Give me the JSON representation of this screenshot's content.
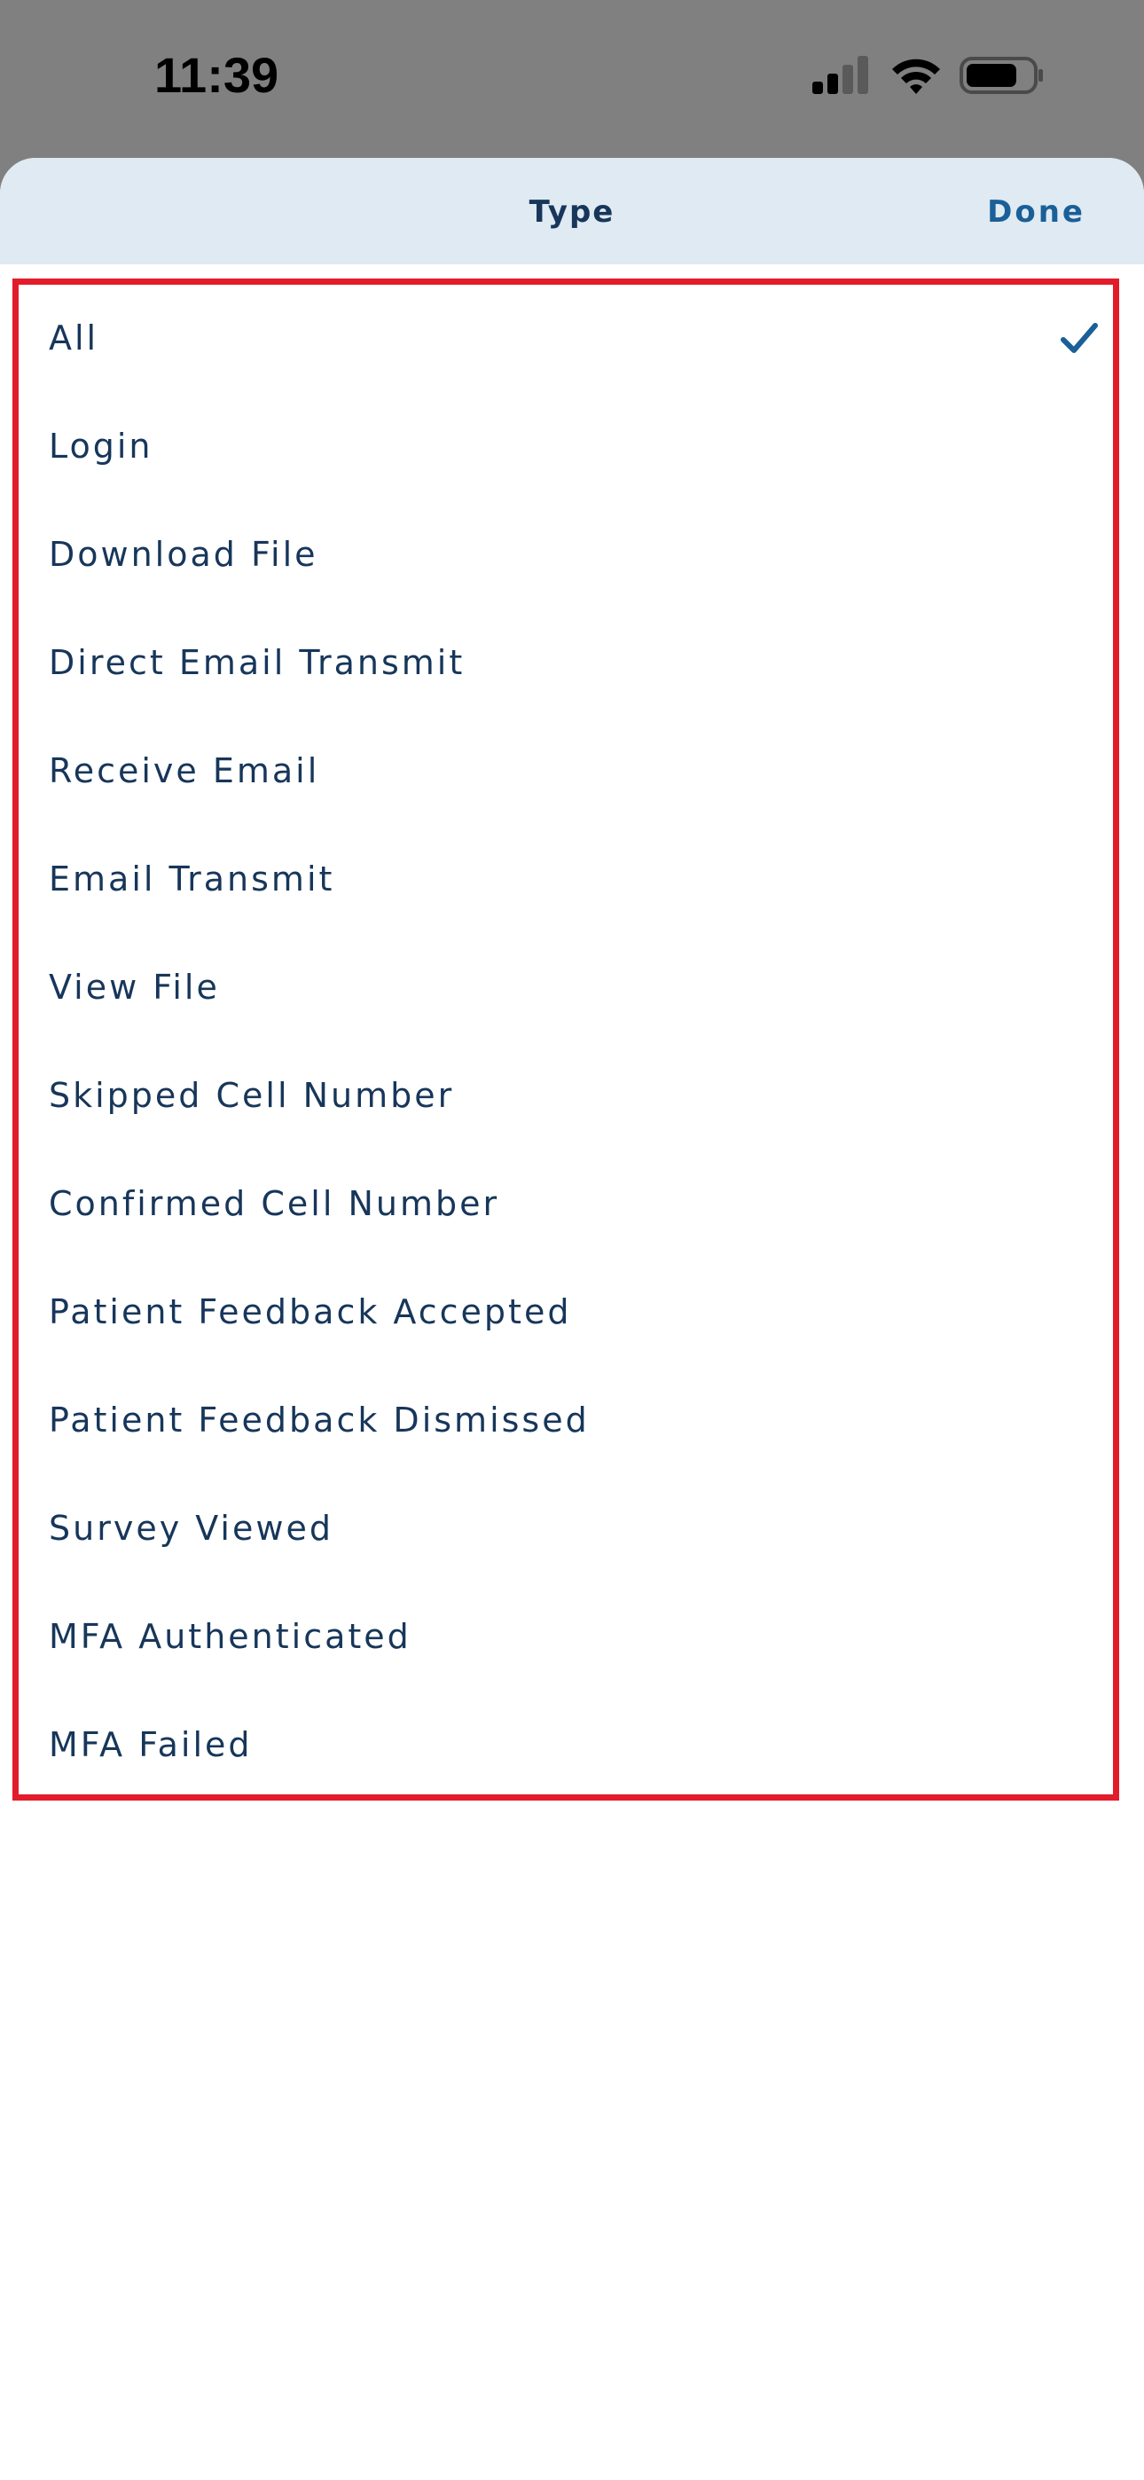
{
  "status_bar": {
    "time": "11:39",
    "signal_icon": "cellular-signal-icon",
    "wifi_icon": "wifi-icon",
    "battery_icon": "battery-icon"
  },
  "sheet": {
    "title": "Type",
    "done_label": "Done",
    "selected_index": 0,
    "options": [
      "All",
      "Login",
      "Download File",
      "Direct Email Transmit",
      "Receive Email",
      "Email Transmit",
      "View File",
      "Skipped Cell Number",
      "Confirmed Cell Number",
      "Patient Feedback Accepted",
      "Patient Feedback Dismissed",
      "Survey Viewed",
      "MFA Authenticated",
      "MFA Failed"
    ]
  },
  "colors": {
    "header_background": "#dfeaf2",
    "text_primary": "#17365a",
    "accent": "#1a5f98",
    "highlight_border": "#e21c2b",
    "backdrop": "#808080"
  }
}
